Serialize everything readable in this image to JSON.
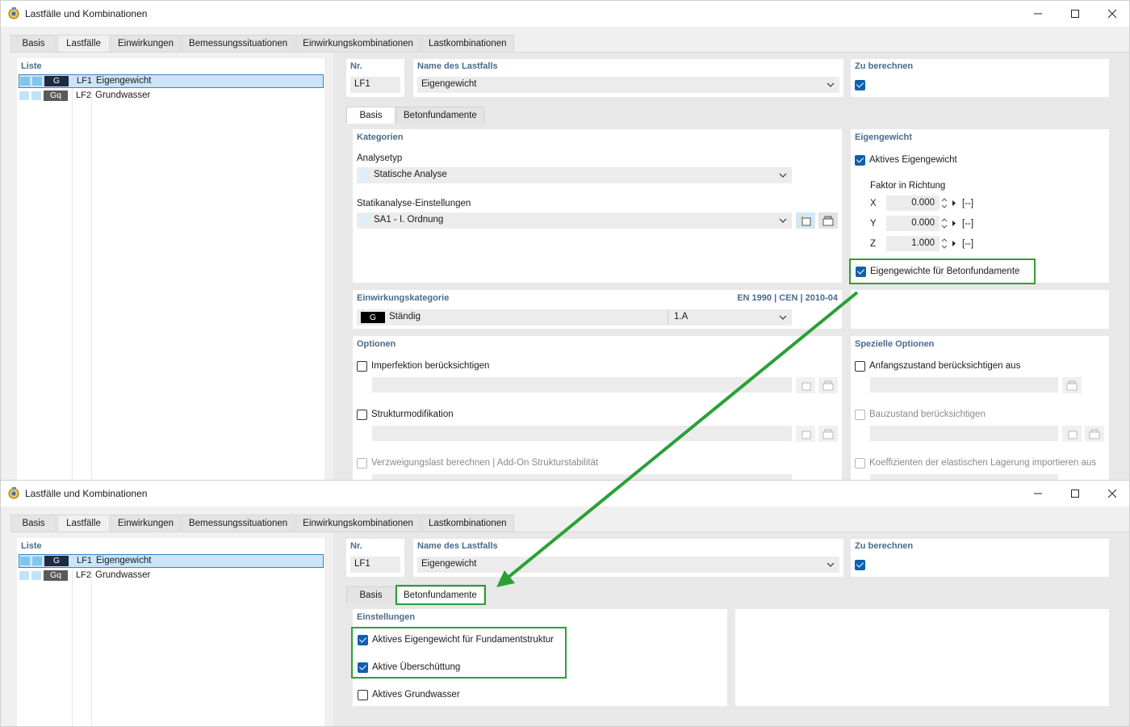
{
  "window1": {
    "title": "Lastfälle und Kombinationen",
    "tabs": [
      "Basis",
      "Lastfälle",
      "Einwirkungen",
      "Bemessungssituationen",
      "Einwirkungskombinationen",
      "Lastkombinationen"
    ],
    "active_tab": "Lastfälle",
    "list": {
      "header": "Liste",
      "items": [
        {
          "abbr": "G",
          "abbr_color": "#1e2a3e",
          "no": "LF1",
          "name": "Eigengewicht",
          "selected": true
        },
        {
          "abbr": "Gq",
          "abbr_color": "#5a5a5a",
          "no": "LF2",
          "name": "Grundwasser",
          "selected": false
        }
      ]
    },
    "header": {
      "nr_label": "Nr.",
      "nr_value": "LF1",
      "name_label": "Name des Lastfalls",
      "name_value": "Eigengewicht",
      "calc_label": "Zu berechnen",
      "calc_checked": true
    },
    "subtabs": [
      "Basis",
      "Betonfundamente"
    ],
    "active_subtab": "Basis",
    "kategorien": {
      "label": "Kategorien",
      "analysetyp_label": "Analysetyp",
      "analysetyp_value": "Statische Analyse",
      "statik_label": "Statikanalyse-Einstellungen",
      "statik_value": "SA1 - I. Ordnung"
    },
    "eigengewicht": {
      "label": "Eigengewicht",
      "aktiv_label": "Aktives Eigengewicht",
      "aktiv_checked": true,
      "faktor_label": "Faktor in Richtung",
      "rows": [
        {
          "axis": "X",
          "value": "0.000",
          "unit": "[--]"
        },
        {
          "axis": "Y",
          "value": "0.000",
          "unit": "[--]"
        },
        {
          "axis": "Z",
          "value": "1.000",
          "unit": "[--]"
        }
      ],
      "beton_label": "Eigengewichte für Betonfundamente",
      "beton_checked": true
    },
    "einwirkung": {
      "label": "Einwirkungskategorie",
      "norm": "EN 1990 | CEN | 2010-04",
      "chip": "G",
      "value": "Ständig",
      "sub": "1.A"
    },
    "optionen": {
      "label": "Optionen",
      "items": [
        {
          "label": "Imperfektion berücksichtigen",
          "enabled": true
        },
        {
          "label": "Strukturmodifikation",
          "enabled": true
        },
        {
          "label": "Verzweigungslast berechnen | Add-On Strukturstabilität",
          "enabled": false
        }
      ]
    },
    "spezielle": {
      "label": "Spezielle Optionen",
      "items": [
        {
          "label": "Anfangszustand berücksichtigen aus",
          "enabled": true
        },
        {
          "label": "Bauzustand berücksichtigen",
          "enabled": false
        },
        {
          "label": "Koeffizienten der elastischen Lagerung importieren aus",
          "enabled": false
        }
      ]
    }
  },
  "window2": {
    "title": "Lastfälle und Kombinationen",
    "tabs": [
      "Basis",
      "Lastfälle",
      "Einwirkungen",
      "Bemessungssituationen",
      "Einwirkungskombinationen",
      "Lastkombinationen"
    ],
    "active_tab": "Lastfälle",
    "list": {
      "header": "Liste",
      "items": [
        {
          "abbr": "G",
          "abbr_color": "#1e2a3e",
          "no": "LF1",
          "name": "Eigengewicht",
          "selected": true
        },
        {
          "abbr": "Gq",
          "abbr_color": "#5a5a5a",
          "no": "LF2",
          "name": "Grundwasser",
          "selected": false
        }
      ]
    },
    "header": {
      "nr_label": "Nr.",
      "nr_value": "LF1",
      "name_label": "Name des Lastfalls",
      "name_value": "Eigengewicht",
      "calc_label": "Zu berechnen",
      "calc_checked": true
    },
    "subtabs": [
      "Basis",
      "Betonfundamente"
    ],
    "active_subtab": "Betonfundamente",
    "einstellungen": {
      "label": "Einstellungen",
      "items": [
        {
          "label": "Aktives Eigengewicht für Fundamentstruktur",
          "checked": true
        },
        {
          "label": "Aktive Überschüttung",
          "checked": true
        },
        {
          "label": "Aktives Grundwasser",
          "checked": false
        }
      ]
    }
  },
  "colors": {
    "highlight": "#2aa037",
    "accent": "#0f5fb0",
    "section_label": "#4a6b8a"
  }
}
